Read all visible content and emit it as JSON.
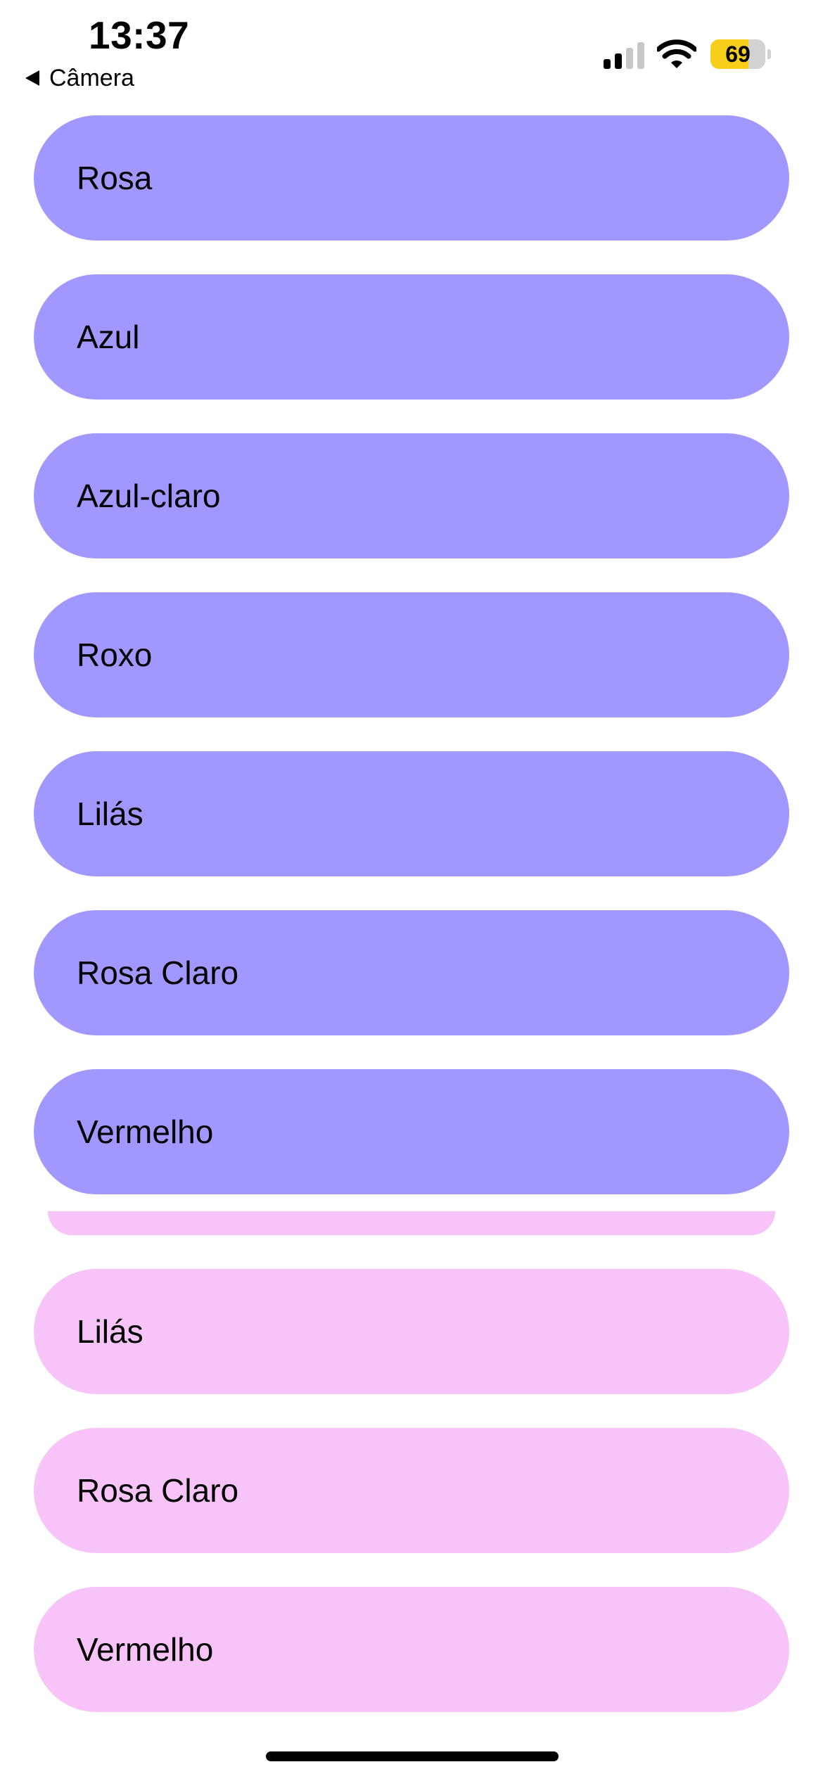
{
  "status_bar": {
    "time": "13:37",
    "back_label": "Câmera",
    "battery_level": "69",
    "battery_fraction": 0.69,
    "signal_bars_active": 2,
    "signal_bars_total": 4,
    "icons": [
      "back-arrow-icon",
      "cellular-signal-icon",
      "wifi-icon",
      "battery-icon"
    ]
  },
  "list_primary": {
    "color": "#a098ff",
    "items": [
      {
        "label": "Rosa"
      },
      {
        "label": "Azul"
      },
      {
        "label": "Azul-claro"
      },
      {
        "label": "Roxo"
      },
      {
        "label": "Lilás"
      },
      {
        "label": "Rosa Claro"
      },
      {
        "label": "Vermelho"
      }
    ]
  },
  "list_secondary": {
    "color": "#f8c3f9",
    "items": [
      {
        "label": "Lilás"
      },
      {
        "label": "Rosa Claro"
      },
      {
        "label": "Vermelho"
      }
    ]
  }
}
